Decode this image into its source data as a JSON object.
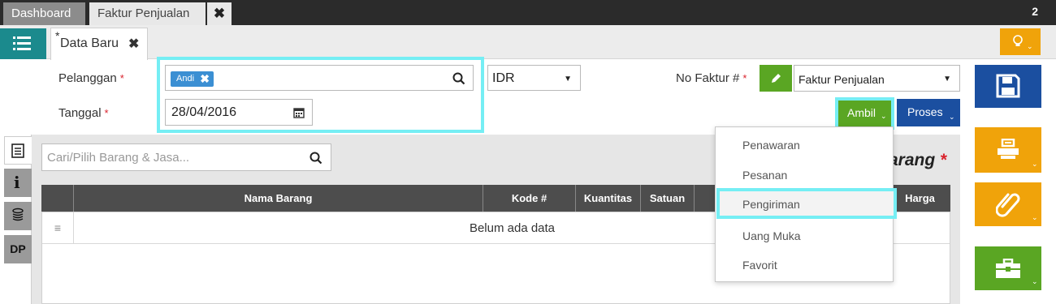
{
  "top_tabs": {
    "dashboard": "Dashboard",
    "faktur": "Faktur Penjualan",
    "close": "✖",
    "count": "2"
  },
  "doc_tab": {
    "dirty": "*",
    "label": "Data Baru",
    "close": "✖"
  },
  "form": {
    "pelanggan_label": "Pelanggan",
    "pelanggan_chip": "Andi",
    "pelanggan_chip_remove": "✖",
    "currency": "IDR",
    "no_faktur_label": "No Faktur #",
    "no_faktur_type": "Faktur Penjualan",
    "tanggal_label": "Tanggal",
    "tanggal_value": "28/04/2016",
    "required_mark": "*"
  },
  "buttons": {
    "ambil": "Ambil",
    "proses": "Proses"
  },
  "search": {
    "placeholder": "Cari/Pilih Barang & Jasa..."
  },
  "side_tabs": {
    "dp": "DP"
  },
  "panel_title": {
    "text": "arang",
    "required": "*"
  },
  "table": {
    "columns": [
      "Nama Barang",
      "Kode #",
      "Kuantitas",
      "Satuan",
      "Harga"
    ],
    "empty_text": "Belum ada data",
    "handle": "≡"
  },
  "ambil_menu": {
    "items": [
      "Penawaran",
      "Pesanan",
      "Pengiriman",
      "Uang Muka",
      "Favorit"
    ],
    "selected": "Pengiriman"
  },
  "icons": {
    "menu": "list-menu-icon",
    "bulb": "lightbulb-icon",
    "search": "search-icon",
    "calendar": "calendar-icon",
    "pencil": "pencil-icon",
    "save": "floppy-disk-icon",
    "print": "printer-icon",
    "attach": "paperclip-icon",
    "briefcase": "briefcase-icon"
  },
  "colors": {
    "teal": "#1b8a8d",
    "green": "#5aa623",
    "blue": "#1b4fa0",
    "orange": "#f0a30a",
    "highlight": "#75eef4"
  }
}
